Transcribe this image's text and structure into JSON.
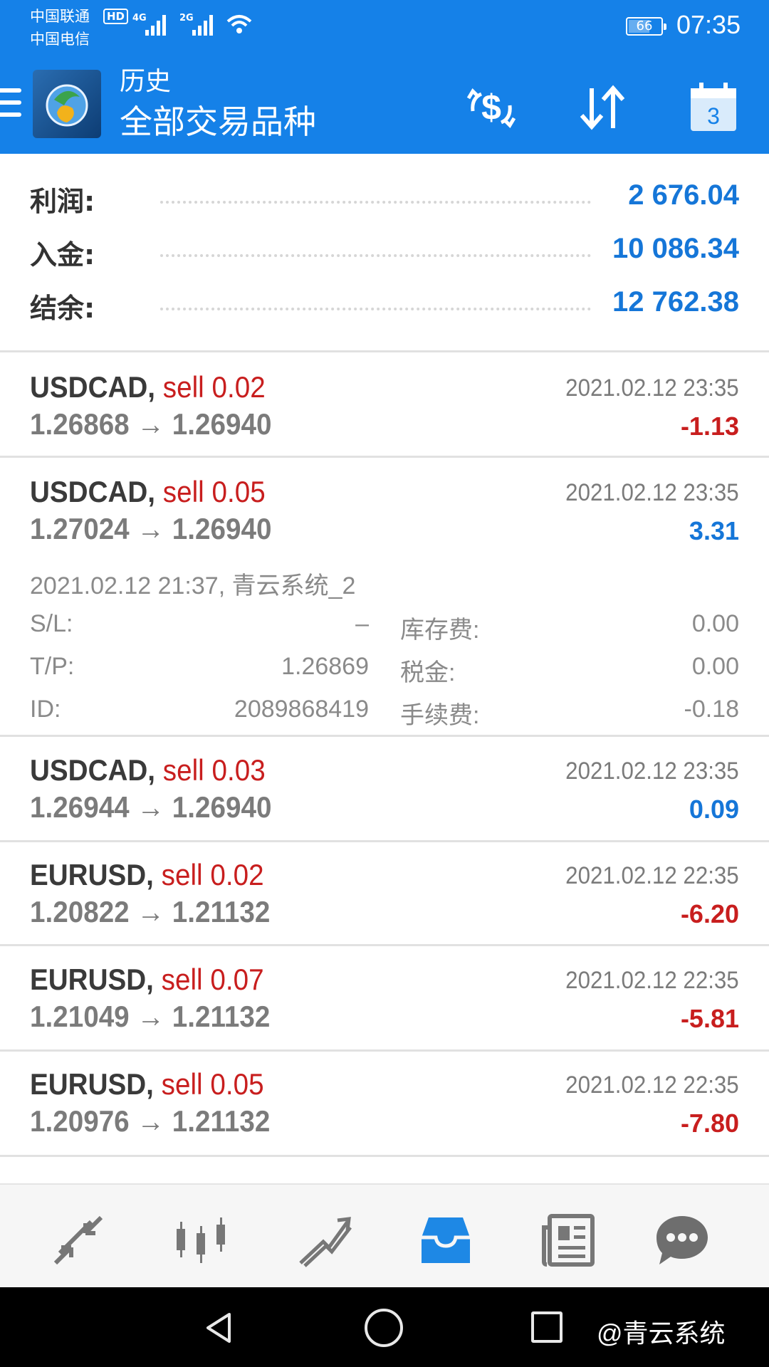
{
  "status_bar": {
    "carrier_1": "中国联通",
    "carrier_2": "中国电信",
    "hd": "HD",
    "network_1": "4G",
    "network_2": "2G",
    "battery": "66",
    "battery_level": 0.66,
    "time": "07:35"
  },
  "app_bar": {
    "title": "历史",
    "subtitle": "全部交易品种",
    "icons": [
      "menu-icon",
      "app-logo",
      "dollar-exchange-icon",
      "sort-icon",
      "calendar-icon"
    ],
    "calendar_day": "3",
    "accent_color": "#1581e8"
  },
  "summary": [
    {
      "label": "利润:",
      "value": "2 676.04"
    },
    {
      "label": "入金:",
      "value": "10 086.34"
    },
    {
      "label": "结余:",
      "value": "12 762.38"
    }
  ],
  "trades": [
    {
      "symbol": "USDCAD,",
      "side": "sell 0.02",
      "prices": "1.26868 → 1.26940",
      "time": "2021.02.12 23:35",
      "profit": "-1.13",
      "profit_type": "neg"
    },
    {
      "symbol": "USDCAD,",
      "side": "sell 0.05",
      "prices": "1.27024 → 1.26940",
      "time": "2021.02.12 23:35",
      "profit": "3.31",
      "profit_type": "pos",
      "details": {
        "title": "2021.02.12 21:37, 青云系统_2",
        "sl_label": "S/L:",
        "sl_value": "–",
        "swap_label": "库存费:",
        "swap_value": "0.00",
        "tp_label": "T/P:",
        "tp_value": "1.26869",
        "tax_label": "税金:",
        "tax_value": "0.00",
        "id_label": "ID:",
        "id_value": "2089868419",
        "fee_label": "手续费:",
        "fee_value": "-0.18"
      }
    },
    {
      "symbol": "USDCAD,",
      "side": "sell 0.03",
      "prices": "1.26944 → 1.26940",
      "time": "2021.02.12 23:35",
      "profit": "0.09",
      "profit_type": "pos"
    },
    {
      "symbol": "EURUSD,",
      "side": "sell 0.02",
      "prices": "1.20822 → 1.21132",
      "time": "2021.02.12 22:35",
      "profit": "-6.20",
      "profit_type": "neg"
    },
    {
      "symbol": "EURUSD,",
      "side": "sell 0.07",
      "prices": "1.21049 → 1.21132",
      "time": "2021.02.12 22:35",
      "profit": "-5.81",
      "profit_type": "neg"
    },
    {
      "symbol": "EURUSD,",
      "side": "sell 0.05",
      "prices": "1.20976 → 1.21132",
      "time": "2021.02.12 22:35",
      "profit": "-7.80",
      "profit_type": "neg"
    }
  ],
  "bottom_nav": {
    "icons": [
      "quotes-icon",
      "chart-icon",
      "trade-icon",
      "history-icon",
      "news-icon",
      "chat-icon"
    ],
    "active": "history-icon"
  },
  "system_nav": {
    "icons": [
      "back-icon",
      "home-icon",
      "recents-icon"
    ],
    "watermark": "@青云系统"
  }
}
